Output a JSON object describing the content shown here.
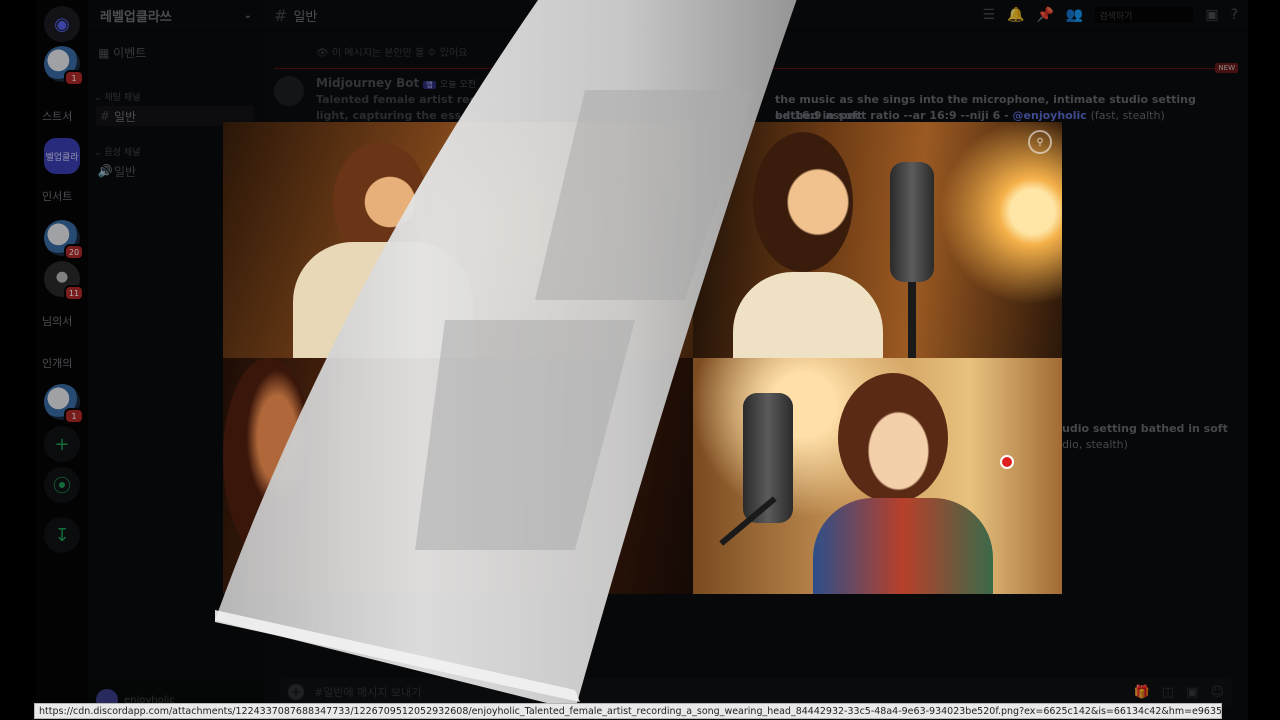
{
  "server": {
    "name": "레벨업클라쓰",
    "events_label": "이벤트",
    "category_chat": "채팅 채널",
    "category_voice": "음성 채널",
    "text_channel": "일반",
    "voice_channel": "일반"
  },
  "rail": {
    "items": [
      {
        "label": "",
        "badge": "1"
      },
      {
        "label": "스트서",
        "badge": ""
      },
      {
        "label": "벨업클라",
        "badge": ""
      },
      {
        "label": "인서트",
        "badge": "1"
      },
      {
        "label": "",
        "badge": "20"
      },
      {
        "label": "",
        "badge": "11"
      },
      {
        "label": "님의서",
        "badge": ""
      },
      {
        "label": "인개의",
        "badge": ""
      },
      {
        "label": "",
        "badge": "1"
      }
    ]
  },
  "user": {
    "name": "enjoyholic"
  },
  "channel_header": {
    "name": "일반",
    "search_placeholder": "검색하기"
  },
  "messages": {
    "ephemeral": "이 메시지는 본인만 볼 수 있어요",
    "new_tag": "NEW",
    "bot_name": "Midjourney Bot",
    "bot_tag": "앱",
    "time": "오늘 오전",
    "line1": "Talented female artist record",
    "line1_tail": "the music as she sings into the microphone, intimate studio setting bathed in soft",
    "line2": "light, capturing the essence",
    "line2_tail": "ed 16:9 aspect ratio --ar 16:9 --niji 6 -",
    "mention": "@enjoyholic",
    "suffix": "(fast, stealth)",
    "line3_tail": "udio setting bathed in soft",
    "line4_tail": "dio, stealth)"
  },
  "composer": {
    "placeholder": "#일반에 메시지 보내기"
  },
  "status_url": "https://cdn.discordapp.com/attachments/1224337087688347733/1226709512052932608/enjoyholic_Talented_female_artist_recording_a_song_wearing_head_84442932-33c5-48a4-9e63-934023be520f.png?ex=6625c142&is=66134c42&hm=e96350f822deeacc21892a2471...",
  "colors": {
    "accent": "#5865f2",
    "badge": "#b52a2a",
    "cursor": "#e02020"
  }
}
